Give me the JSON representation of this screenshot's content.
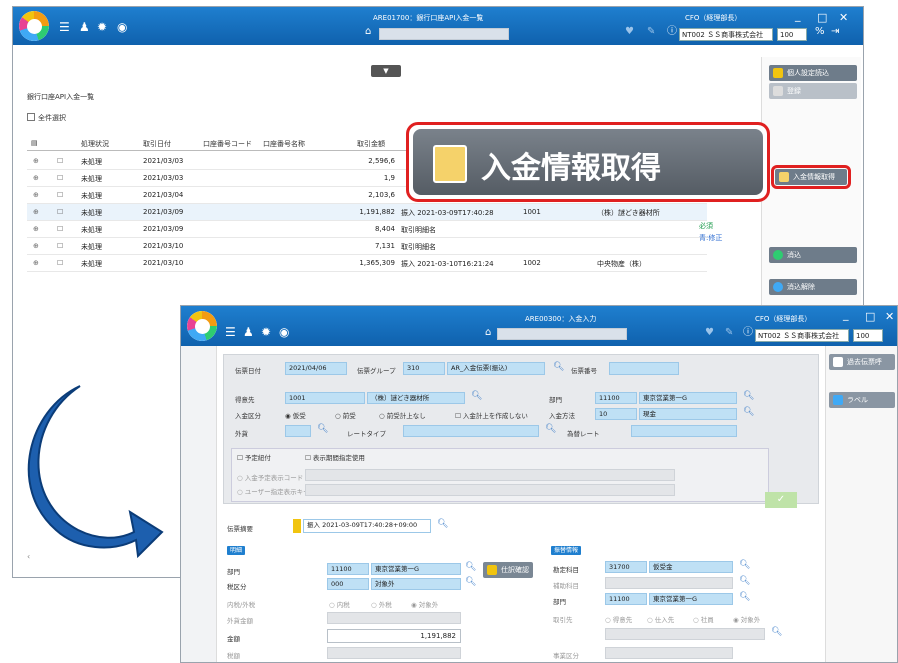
{
  "back_window": {
    "title": "ARE01700：銀行口座API入金一覧",
    "user": "CFO（経理部長）",
    "company_select": "NT002 ＳＳ商事株式会社",
    "page_size": "100",
    "page_heading": "銀行口座API入金一覧",
    "select_all_label": "全件選択",
    "columns": [
      "処理状況",
      "取引日付",
      "口座番号コード",
      "口座番号名称",
      "取引金額"
    ],
    "rows": [
      {
        "status": "未処理",
        "date": "2021/03/03",
        "amount": "2,596,6",
        "detail": "",
        "code": "",
        "name": ""
      },
      {
        "status": "未処理",
        "date": "2021/03/03",
        "amount": "1,9",
        "detail": "",
        "code": "",
        "name": ""
      },
      {
        "status": "未処理",
        "date": "2021/03/04",
        "amount": "2,103,6",
        "detail": "",
        "code": "",
        "name": ""
      },
      {
        "status": "未処理",
        "date": "2021/03/09",
        "amount": "1,191,882",
        "detail": "振入 2021-03-09T17:40:28",
        "code": "1001",
        "name": "（株）謎どき器材所"
      },
      {
        "status": "未処理",
        "date": "2021/03/09",
        "amount": "8,404",
        "detail": "取引明細名",
        "code": "",
        "name": ""
      },
      {
        "status": "未処理",
        "date": "2021/03/10",
        "amount": "7,131",
        "detail": "取引明細名",
        "code": "",
        "name": ""
      },
      {
        "status": "未処理",
        "date": "2021/03/10",
        "amount": "1,365,309",
        "detail": "振入 2021-03-10T16:21:24",
        "code": "1002",
        "name": "中央物産（株）"
      }
    ],
    "side_legend": [
      "必須",
      "青:修正"
    ],
    "buttons": {
      "import": "個人設定読込",
      "b2": "登録",
      "fetch": "入金情報取得",
      "process": "消込",
      "cancel": "消込解除"
    }
  },
  "callout": {
    "label": "入金情報取得"
  },
  "front_window": {
    "title": "ARE00300：入金入力",
    "user": "CFO（経理部長）",
    "company_select": "NT002 ＳＳ商事株式会社",
    "page_size": "100",
    "right_buttons": [
      "過去伝票呼",
      "ラベル"
    ],
    "form": {
      "voucher_date_label": "伝票日付",
      "voucher_date": "2021/04/06",
      "voucher_group_label": "伝票グループ",
      "voucher_group_code": "310",
      "voucher_group_name": "AR_入金伝票(振込)",
      "voucher_no_label": "伝票番号",
      "customer_label": "得意先",
      "customer_code": "1001",
      "customer_name": "（株）謎どき器材所",
      "dept_label": "部門",
      "dept_code": "11100",
      "dept_name": "東京営業第一G",
      "payment_label": "入金区分",
      "radio1": "仮受",
      "radio2": "前受",
      "radio3": "前受計上なし",
      "checkbox_no_credit": "入金計上を作成しない",
      "method_label": "入金方法",
      "method_code": "10",
      "method_name": "現金",
      "currency_label": "外貨",
      "rate_type_label": "レートタイプ",
      "rate_label": "為替レート",
      "schedule_label": "予定紐付",
      "check_label": "表示期間指定使用",
      "plan_code_label": "入金予定表示コード",
      "user_def_label": "ユーザー指定表示キー",
      "detail_label": "伝票摘要",
      "detail_value": "振入 2021-03-09T17:40:28+09:00",
      "left_section": "明細",
      "dept2_label": "部門",
      "dept2_code": "11100",
      "dept2_name": "東京営業第一G",
      "tax_label": "税区分",
      "tax_code": "000",
      "tax_name": "対象外",
      "journal_btn": "仕訳確認",
      "incl_label": "内税/外税",
      "r_in": "内税",
      "r_out": "外税",
      "r_none": "対象外",
      "foreign_label": "外貨金額",
      "amount_label": "金額",
      "amount_value": "1,191,882",
      "tax_amount_label": "税額",
      "right_section": "振替情報",
      "account_label": "勘定科目",
      "account_code": "31700",
      "account_name": "仮受金",
      "sub_label": "補助科目",
      "dept3_label": "部門",
      "dept3_code": "11100",
      "dept3_name": "東京営業第一G",
      "partner_label": "取引先",
      "p1": "得意先",
      "p2": "仕入先",
      "p3": "社員",
      "p4": "対象外",
      "misc_label": "事業区分"
    }
  },
  "colors": {
    "titlebar": "#1f7fcf",
    "callout_border": "#e02020",
    "arrow": "#1d5fae"
  }
}
